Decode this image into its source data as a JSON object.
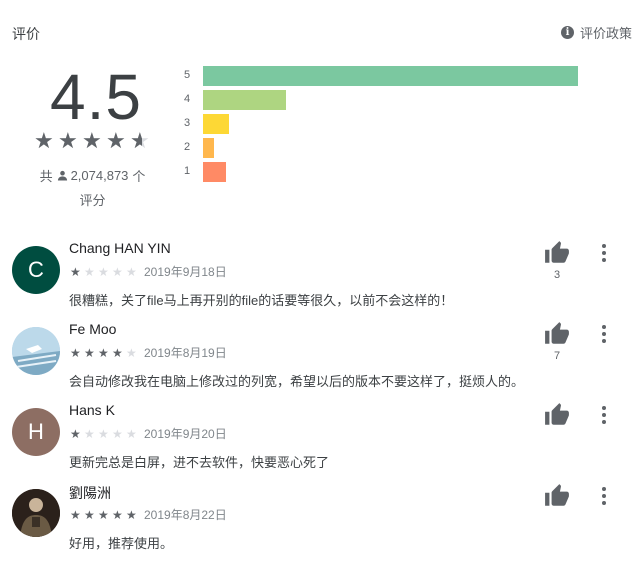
{
  "header": {
    "title": "评价",
    "policy_label": "评价政策",
    "policy_icon": "info-icon"
  },
  "summary": {
    "score": "4.5",
    "star_rating": 4.5,
    "total_prefix": "共",
    "total_count": "2,074,873",
    "total_suffix": "个",
    "total_unit": "评分",
    "bars": [
      {
        "label": "5",
        "fraction": 1.0,
        "color": "#7bc8a0"
      },
      {
        "label": "4",
        "fraction": 0.22,
        "color": "#aed581"
      },
      {
        "label": "3",
        "fraction": 0.07,
        "color": "#fdd835"
      },
      {
        "label": "2",
        "fraction": 0.03,
        "color": "#ffb74d"
      },
      {
        "label": "1",
        "fraction": 0.06,
        "color": "#ff8a65"
      }
    ]
  },
  "reviews": [
    {
      "name": "Chang HAN YIN",
      "initial": "C",
      "avatar_color": "#004d40",
      "stars": 1,
      "date": "2019年9月18日",
      "text": "很糟糕，关了file马上再开别的file的话要等很久，以前不会这样的！",
      "helpful": "3"
    },
    {
      "name": "Fe Moo",
      "initial": "",
      "avatar_color": "#a8c8e0",
      "stars": 4,
      "date": "2019年8月19日",
      "text": "会自动修改我在电脑上修改过的列宽，希望以后的版本不要这样了，挺烦人的。",
      "helpful": "7"
    },
    {
      "name": "Hans K",
      "initial": "H",
      "avatar_color": "#8d6e63",
      "stars": 1,
      "date": "2019年9月20日",
      "text": "更新完总是白屏，进不去软件，快要恶心死了",
      "helpful": ""
    },
    {
      "name": "劉陽洲",
      "initial": "",
      "avatar_color": "#3e2f25",
      "stars": 5,
      "date": "2019年8月22日",
      "text": "好用，推荐使用。",
      "helpful": ""
    }
  ]
}
